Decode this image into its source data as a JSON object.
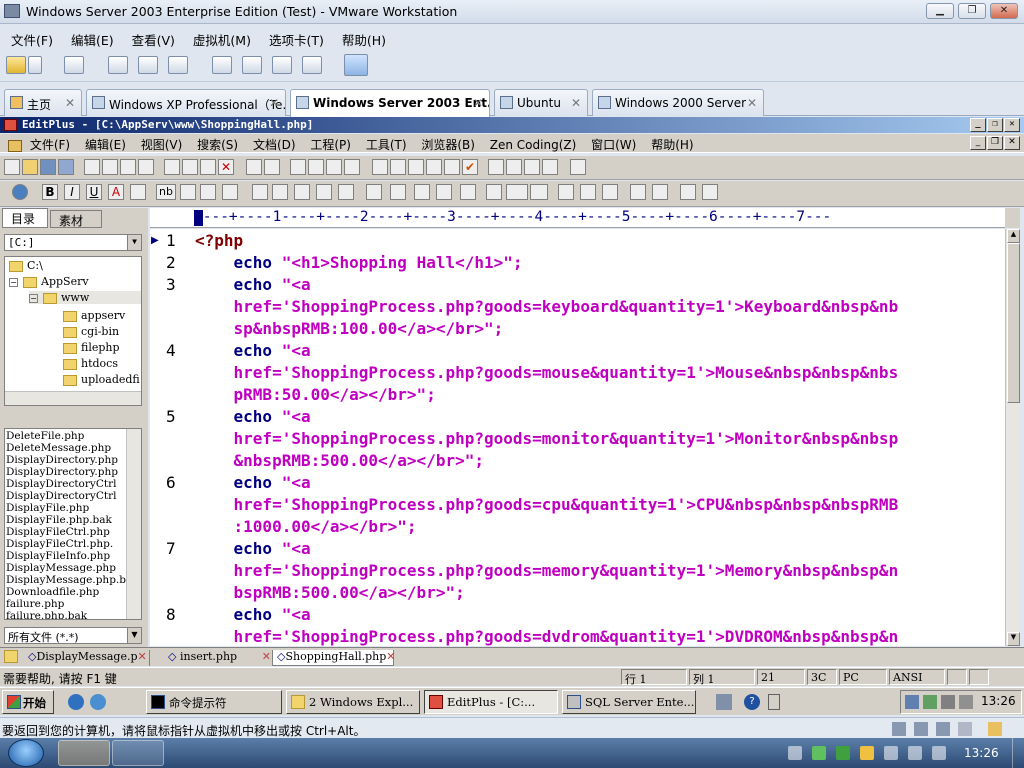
{
  "vmware": {
    "title": "Windows Server 2003 Enterprise Edition (Test) - VMware Workstation",
    "menu": [
      "文件(F)",
      "编辑(E)",
      "查看(V)",
      "虚拟机(M)",
      "选项卡(T)",
      "帮助(H)"
    ],
    "tabs": [
      {
        "label": "主页",
        "active": false
      },
      {
        "label": "Windows XP Professional（Te...",
        "active": false
      },
      {
        "label": "Windows Server 2003 Ent...",
        "active": true
      },
      {
        "label": "Ubuntu",
        "active": false
      },
      {
        "label": "Windows 2000 Server",
        "active": false
      }
    ]
  },
  "editplus": {
    "title": "EditPlus - [C:\\AppServ\\www\\ShoppingHall.php]",
    "menu": [
      "文件(F)",
      "编辑(E)",
      "视图(V)",
      "搜索(S)",
      "文档(D)",
      "工程(P)",
      "工具(T)",
      "浏览器(B)",
      "Zen Coding(Z)",
      "窗口(W)",
      "帮助(H)"
    ],
    "left_tabs": [
      "目录",
      "素材"
    ],
    "drive": "[C:]",
    "tree": [
      {
        "label": "C:\\",
        "level": 0
      },
      {
        "label": "AppServ",
        "level": 1
      },
      {
        "label": "www",
        "level": 2
      },
      {
        "label": "appserv",
        "level": 3
      },
      {
        "label": "cgi-bin",
        "level": 3
      },
      {
        "label": "filephp",
        "level": 3
      },
      {
        "label": "htdocs",
        "level": 3
      },
      {
        "label": "uploadedfi",
        "level": 3
      }
    ],
    "files": [
      "DeleteFile.php",
      "DeleteMessage.php",
      "DisplayDirectory.php",
      "DisplayDirectory.php",
      "DisplayDirectoryCtrl",
      "DisplayDirectoryCtrl",
      "DisplayFile.php",
      "DisplayFile.php.bak",
      "DisplayFileCtrl.php",
      "DisplayFileCtrl.php.",
      "DisplayFileInfo.php",
      "DisplayMessage.php",
      "DisplayMessage.php.b",
      "Downloadfile.php",
      "failure.php",
      "failure.php.bak"
    ],
    "filter": "所有文件 (*.*)",
    "ruler": "----+----1----+----2----+----3----+----4----+----5----+----6----+----7---",
    "code": [
      {
        "num": "1",
        "lines": [
          [
            {
              "c": "tag",
              "t": "<?php"
            }
          ]
        ]
      },
      {
        "num": "2",
        "lines": [
          [
            {
              "c": "kw",
              "t": "    echo "
            },
            {
              "c": "str",
              "t": "\"<h1>Shopping Hall</h1>\";"
            }
          ]
        ]
      },
      {
        "num": "3",
        "lines": [
          [
            {
              "c": "kw",
              "t": "    echo "
            },
            {
              "c": "str",
              "t": "\"<a"
            }
          ],
          [
            {
              "c": "str",
              "t": "    href='ShoppingProcess.php?goods=keyboard&quantity=1'>Keyboard&nbsp&nb"
            }
          ],
          [
            {
              "c": "str",
              "t": "    sp&nbspRMB:100.00</a></br>\";"
            }
          ]
        ]
      },
      {
        "num": "4",
        "lines": [
          [
            {
              "c": "kw",
              "t": "    echo "
            },
            {
              "c": "str",
              "t": "\"<a"
            }
          ],
          [
            {
              "c": "str",
              "t": "    href='ShoppingProcess.php?goods=mouse&quantity=1'>Mouse&nbsp&nbsp&nbs"
            }
          ],
          [
            {
              "c": "str",
              "t": "    pRMB:50.00</a></br>\";"
            }
          ]
        ]
      },
      {
        "num": "5",
        "lines": [
          [
            {
              "c": "kw",
              "t": "    echo "
            },
            {
              "c": "str",
              "t": "\"<a"
            }
          ],
          [
            {
              "c": "str",
              "t": "    href='ShoppingProcess.php?goods=monitor&quantity=1'>Monitor&nbsp&nbsp"
            }
          ],
          [
            {
              "c": "str",
              "t": "    &nbspRMB:500.00</a></br>\";"
            }
          ]
        ]
      },
      {
        "num": "6",
        "lines": [
          [
            {
              "c": "kw",
              "t": "    echo "
            },
            {
              "c": "str",
              "t": "\"<a"
            }
          ],
          [
            {
              "c": "str",
              "t": "    href='ShoppingProcess.php?goods=cpu&quantity=1'>CPU&nbsp&nbsp&nbspRMB"
            }
          ],
          [
            {
              "c": "str",
              "t": "    :1000.00</a></br>\";"
            }
          ]
        ]
      },
      {
        "num": "7",
        "lines": [
          [
            {
              "c": "kw",
              "t": "    echo "
            },
            {
              "c": "str",
              "t": "\"<a"
            }
          ],
          [
            {
              "c": "str",
              "t": "    href='ShoppingProcess.php?goods=memory&quantity=1'>Memory&nbsp&nbsp&n"
            }
          ],
          [
            {
              "c": "str",
              "t": "    bspRMB:500.00</a></br>\";"
            }
          ]
        ]
      },
      {
        "num": "8",
        "lines": [
          [
            {
              "c": "kw",
              "t": "    echo "
            },
            {
              "c": "str",
              "t": "\"<a"
            }
          ],
          [
            {
              "c": "str",
              "t": "    href='ShoppingProcess.php?goods=dvdrom&quantity=1'>DVDROM&nbsp&nbsp&n"
            }
          ]
        ]
      }
    ],
    "doc_tabs": [
      "DisplayMessage.p",
      "insert.php",
      "ShoppingHall.php"
    ],
    "status": {
      "help": "需要帮助, 请按 F1 键",
      "row": "行 1",
      "col": "列 1",
      "chars": "21",
      "hex": "3C",
      "mode": "PC",
      "encoding": "ANSI"
    }
  },
  "guest_taskbar": {
    "start": "开始",
    "items": [
      "命令提示符",
      "2 Windows Expl...",
      "EditPlus - [C:...",
      "SQL Server Ente..."
    ],
    "time": "13:26"
  },
  "host": {
    "hint": "要返回到您的计算机，请将鼠标指针从虚拟机中移出或按 Ctrl+Alt。",
    "time": "13:26"
  }
}
